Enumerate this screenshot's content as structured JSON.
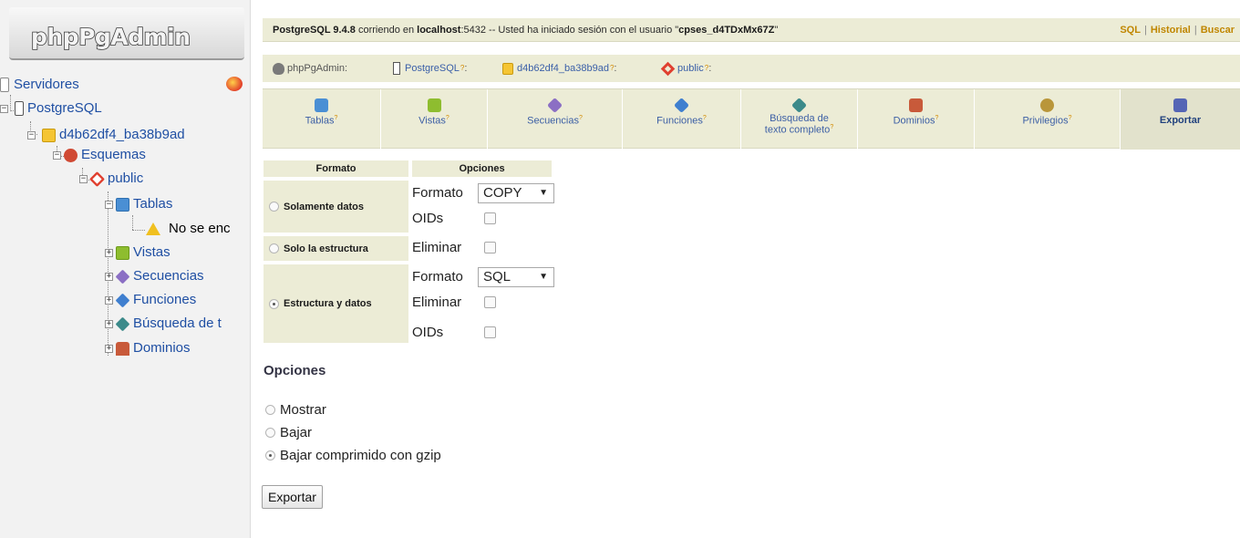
{
  "logo": {
    "text": "phpPgAdmin"
  },
  "tree": {
    "servers": "Servidores",
    "postgres": "PostgreSQL",
    "database": "d4b62df4_ba38b9ad",
    "schemas": "Esquemas",
    "public": "public",
    "tables": "Tablas",
    "not_found": "No se enc",
    "views": "Vistas",
    "sequences": "Secuencias",
    "functions": "Funciones",
    "fulltext": "Búsqueda de t",
    "domains": "Dominios"
  },
  "topbar": {
    "server": "PostgreSQL 9.4.8",
    "running_on": " corriendo en ",
    "host": "localhost",
    "port_text": ":5432 -- Usted ha iniciado sesión con el usuario \"",
    "user": "cpses_d4TDxMx67Z",
    "quote": "\"",
    "links": [
      "SQL",
      "Historial",
      "Buscar"
    ]
  },
  "breadcrumb": {
    "app": "phpPgAdmin:",
    "server": "PostgreSQL",
    "db": "d4b62df4_ba38b9ad",
    "schema": "public",
    "q": "?",
    "sep": ":"
  },
  "tabs": [
    {
      "label": "Tablas",
      "icon": "table-icon",
      "color": "#4a8fd4"
    },
    {
      "label": "Vistas",
      "icon": "views-icon",
      "color": "#8ebd2f"
    },
    {
      "label": "Secuencias",
      "icon": "sequence-icon",
      "color": "#8b6fc4"
    },
    {
      "label": "Funciones",
      "icon": "function-icon",
      "color": "#3f7fcf"
    },
    {
      "label": "Búsqueda de",
      "label2": "texto completo",
      "icon": "fulltext-icon",
      "color": "#3b8a8a"
    },
    {
      "label": "Dominios",
      "icon": "domain-icon",
      "color": "#c85a3a"
    },
    {
      "label": "Privilegios",
      "icon": "privileges-icon",
      "color": "#b9963a"
    },
    {
      "label": "Exportar",
      "icon": "export-icon",
      "color": "#5565b5",
      "active": true
    }
  ],
  "format_table": {
    "header_format": "Formato",
    "header_options": "Opciones",
    "row_data_only": "Solamente datos",
    "row_structure_only": "Solo la estructura",
    "row_struct_and_data": "Estructura y datos",
    "label_format": "Formato",
    "label_oids": "OIDs",
    "label_drop": "Eliminar",
    "select_copy": "COPY",
    "select_sql": "SQL",
    "selected_row": "row_struct_and_data"
  },
  "options": {
    "title": "Opciones",
    "show": "Mostrar",
    "download": "Bajar",
    "download_gzip": "Bajar comprimido con gzip",
    "selected": "download_gzip"
  },
  "export_button": "Exportar",
  "colors": {
    "panel_bg": "#ececd6",
    "link_blue": "#3c5fa5",
    "accent_orange": "#c08600",
    "tree_bg": "#f2f2f2"
  }
}
